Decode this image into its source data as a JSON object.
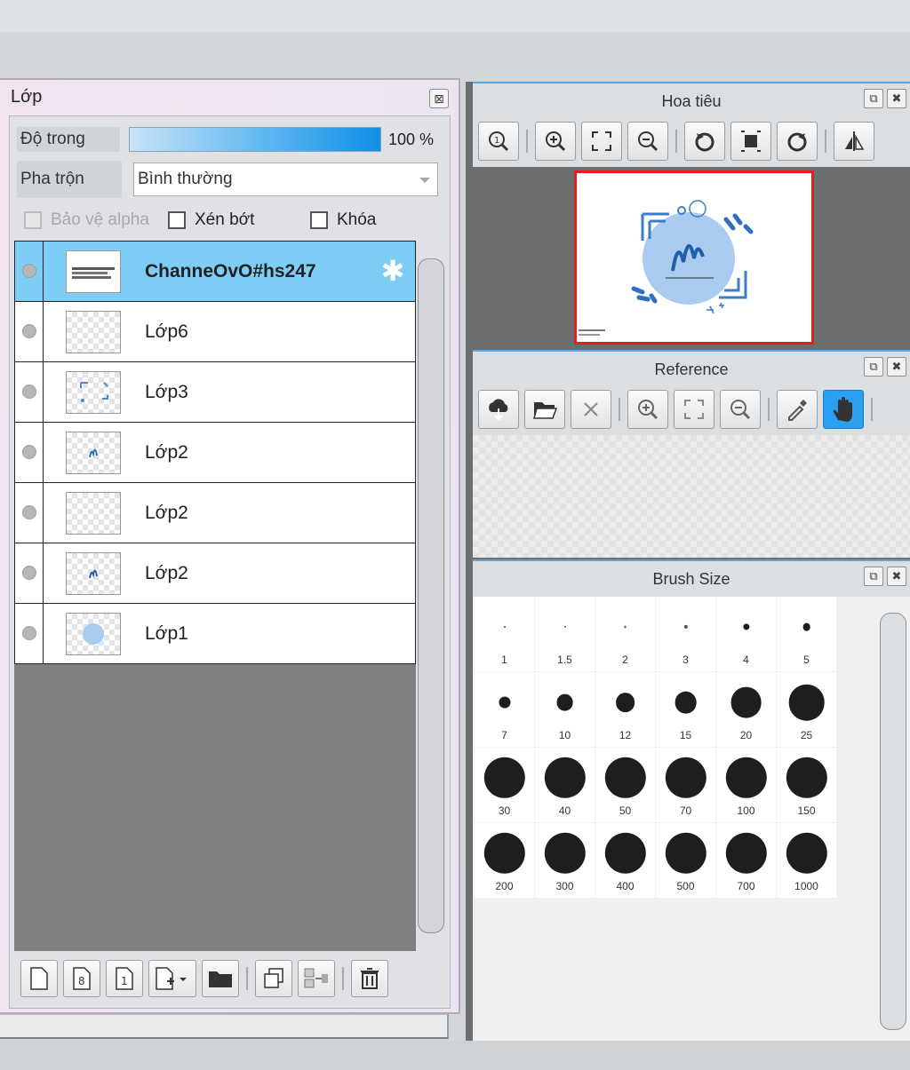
{
  "layer_panel": {
    "title": "Lớp",
    "close": "⊠",
    "opacity_label": "Độ trong",
    "opacity_value": "100 %",
    "opacity_percent": 100,
    "blend_label": "Pha trộn",
    "blend_value": "Bình thường",
    "checks": {
      "protect_alpha": "Bảo vệ alpha",
      "clipping": "Xén bớt",
      "lock": "Khóa"
    },
    "layers": [
      {
        "name": "ChanneOvO#hs247",
        "selected": true
      },
      {
        "name": "Lớp6",
        "selected": false
      },
      {
        "name": "Lớp3",
        "selected": false
      },
      {
        "name": "Lớp2",
        "selected": false
      },
      {
        "name": "Lớp2",
        "selected": false
      },
      {
        "name": "Lớp2",
        "selected": false
      },
      {
        "name": "Lớp1",
        "selected": false
      }
    ]
  },
  "navigator": {
    "title": "Hoa tiêu"
  },
  "reference": {
    "title": "Reference"
  },
  "brush_size": {
    "title": "Brush Size",
    "sizes": [
      "1",
      "1.5",
      "2",
      "3",
      "4",
      "5",
      "7",
      "10",
      "12",
      "15",
      "20",
      "25",
      "30",
      "40",
      "50",
      "70",
      "100",
      "150",
      "200",
      "300",
      "400",
      "500",
      "700",
      "1000"
    ]
  },
  "colors": {
    "accent": "#29a0ef",
    "selected_layer": "#7ecdf5",
    "nav_frame": "#e21e1e"
  }
}
